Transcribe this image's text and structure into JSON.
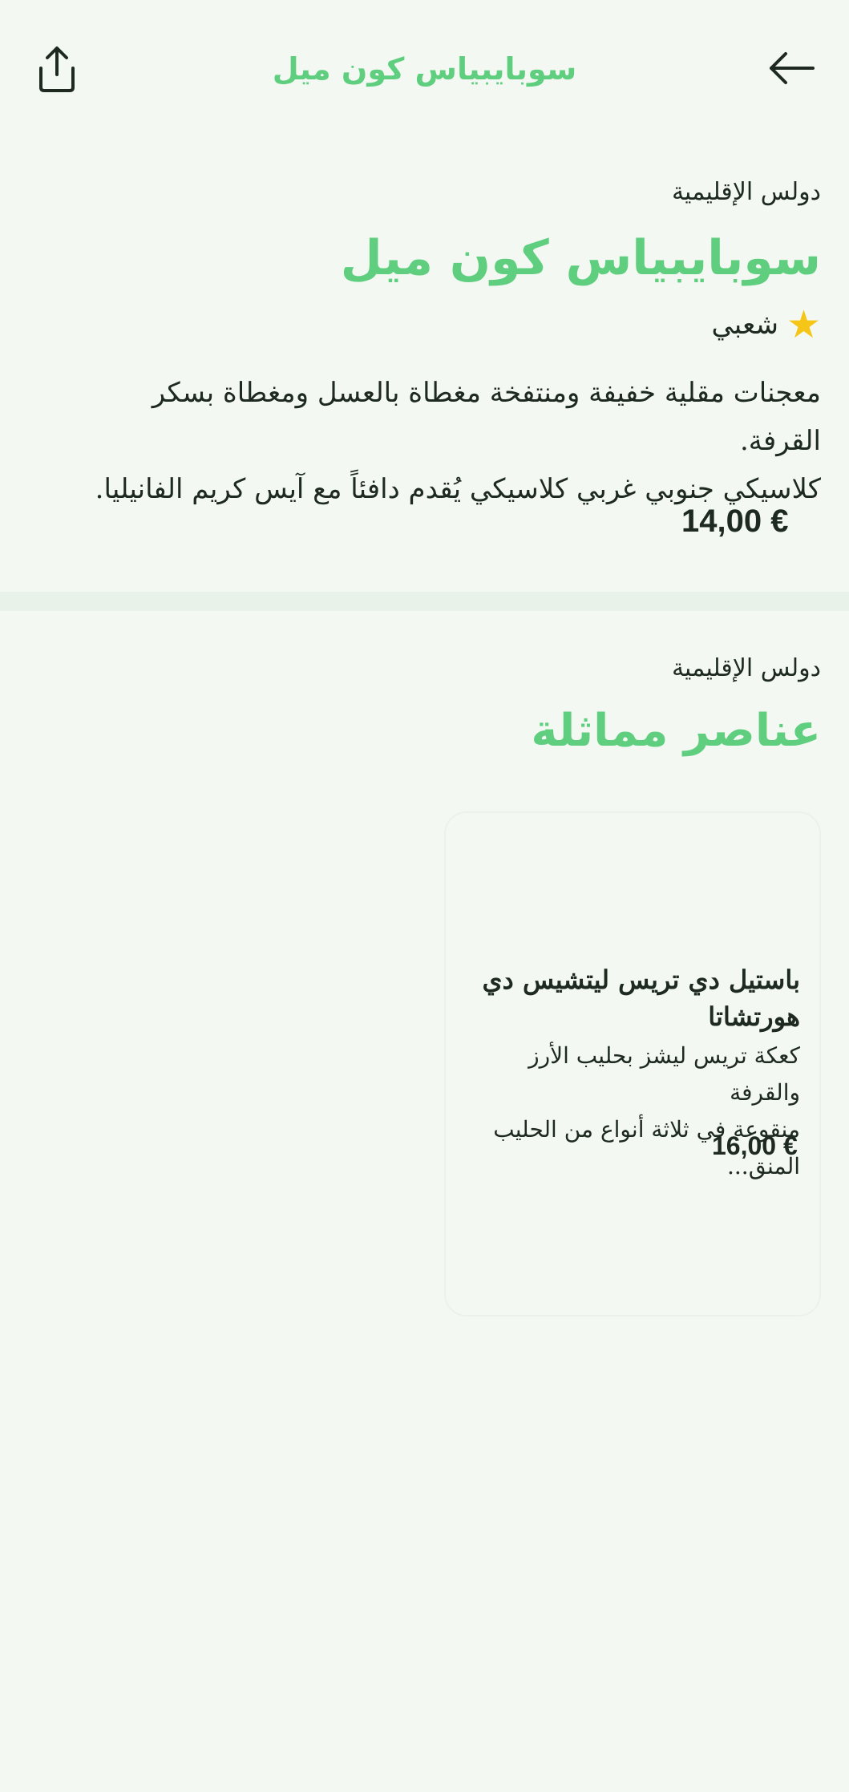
{
  "header": {
    "title": "سوبايبياس كون ميل",
    "share_icon": "share-icon",
    "back_icon": "arrow-left-icon"
  },
  "product": {
    "category": "دولس الإقليمية",
    "name": "سوبايبياس كون ميل",
    "rating": {
      "icon": "star-icon",
      "star_glyph": "★",
      "label": "شعبي"
    },
    "description_lines": [
      "معجنات مقلية خفيفة ومنتفخة مغطاة بالعسل ومغطاة بسكر القرفة.",
      "كلاسيكي جنوبي غربي كلاسيكي يُقدم دافئاً مع آيس كريم الفانيليا."
    ],
    "price": "14,00 €"
  },
  "similar": {
    "category": "دولس الإقليمية",
    "title": "عناصر مماثلة",
    "items": [
      {
        "name_lines": [
          "باستيل دي تريس ليتشيس دي",
          "هورتشاتا"
        ],
        "description_lines": [
          "كعكة تريس ليشز بحليب الأرز والقرفة",
          "منقوعة في ثلاثة أنواع من الحليب المنق..."
        ],
        "price": "16,00 €"
      }
    ]
  },
  "colors": {
    "background": "#f3f8f2",
    "accent": "#5fcf7f",
    "text": "#1e2a1f",
    "star": "#f5c518"
  }
}
